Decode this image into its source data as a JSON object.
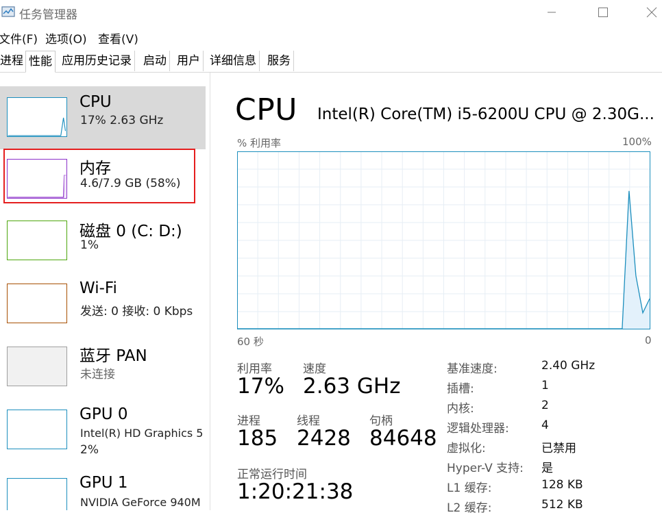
{
  "window": {
    "title": "任务管理器"
  },
  "menu": [
    "文件(F)",
    "选项(O)",
    "查看(V)"
  ],
  "tabs": [
    "进程",
    "性能",
    "应用历史记录",
    "启动",
    "用户",
    "详细信息",
    "服务"
  ],
  "active_tab": "性能",
  "sidebar": {
    "items": [
      {
        "name": "CPU",
        "detail": "17% 2.63 GHz",
        "color": "#1b8ebd",
        "usage": 0.17
      },
      {
        "name": "内存",
        "detail": "4.6/7.9 GB (58%)",
        "color": "#8b2fc9",
        "usage": 0.58
      },
      {
        "name": "磁盘 0 (C: D:)",
        "detail": "1%",
        "color": "#4da60c",
        "usage": 0.01
      },
      {
        "name": "Wi-Fi",
        "detail": "发送: 0 接收: 0 Kbps",
        "color": "#a74f01",
        "usage": 0
      },
      {
        "name": "蓝牙 PAN",
        "detail": "未连接",
        "color": "#9e9e9e",
        "usage": 0
      },
      {
        "name": "GPU 0",
        "detail": "Intel(R) HD Graphics 5",
        "detail2": "2%",
        "color": "#1b8ebd",
        "usage": 0.02
      },
      {
        "name": "GPU 1",
        "detail": "NVIDIA GeForce 940M",
        "color": "#1b8ebd",
        "usage": 0
      }
    ]
  },
  "main": {
    "title": "CPU",
    "model": "Intel(R) Core(TM) i5-6200U CPU @ 2.30G...",
    "graph": {
      "ylabel": "% 利用率",
      "ymax_label": "100%",
      "xlabel_left": "60 秒",
      "xlabel_right": "0",
      "line_color": "#1b8ebd",
      "fill_color": "#e3f1fb",
      "samples_pct": [
        0,
        0,
        0,
        0,
        0,
        0,
        0,
        0,
        0,
        0,
        0,
        0,
        0,
        0,
        0,
        0,
        0,
        0,
        0,
        0,
        0,
        0,
        0,
        0,
        0,
        0,
        0,
        0,
        0,
        0,
        0,
        0,
        0,
        0,
        0,
        0,
        0,
        0,
        0,
        0,
        0,
        0,
        0,
        0,
        0,
        0,
        0,
        0,
        0,
        0,
        0,
        0,
        0,
        0,
        0,
        0,
        0,
        78,
        30,
        9,
        17
      ]
    },
    "stats": {
      "utilization": {
        "label": "利用率",
        "value": "17%"
      },
      "speed": {
        "label": "速度",
        "value": "2.63 GHz"
      },
      "processes": {
        "label": "进程",
        "value": "185"
      },
      "threads": {
        "label": "线程",
        "value": "2428"
      },
      "handles": {
        "label": "句柄",
        "value": "84648"
      },
      "uptime": {
        "label": "正常运行时间",
        "value": "1:20:21:38"
      }
    },
    "specs": [
      {
        "k": "基准速度:",
        "v": "2.40 GHz"
      },
      {
        "k": "插槽:",
        "v": "1"
      },
      {
        "k": "内核:",
        "v": "2"
      },
      {
        "k": "逻辑处理器:",
        "v": "4"
      },
      {
        "k": "虚拟化:",
        "v": "已禁用"
      },
      {
        "k": "Hyper-V 支持:",
        "v": "是"
      },
      {
        "k": "L1 缓存:",
        "v": "128 KB"
      },
      {
        "k": "L2 缓存:",
        "v": "512 KB"
      }
    ]
  }
}
